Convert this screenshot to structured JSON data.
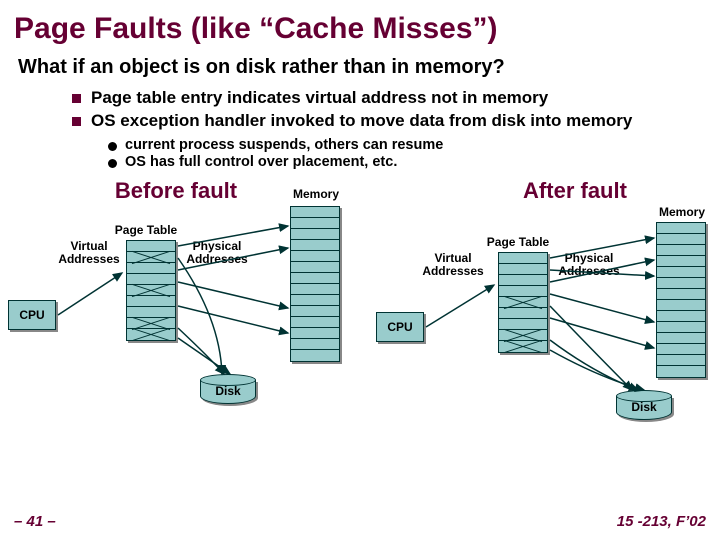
{
  "title": "Page Faults (like “Cache Misses”)",
  "subtitle": "What if an object is on disk rather than in memory?",
  "bullets": [
    "Page table entry indicates virtual address not in memory",
    "OS exception handler invoked to move data from disk into memory"
  ],
  "sub_bullets": [
    "current process suspends, others can resume",
    "OS has full control over placement, etc."
  ],
  "diagrams": {
    "before": {
      "title": "Before fault",
      "labels": {
        "memory": "Memory",
        "page_table": "Page Table",
        "virtual": "Virtual\nAddresses",
        "physical": "Physical\nAddresses",
        "cpu": "CPU",
        "disk": "Disk"
      }
    },
    "after": {
      "title": "After fault",
      "labels": {
        "memory": "Memory",
        "page_table": "Page Table",
        "virtual": "Virtual\nAddresses",
        "physical": "Physical\nAddresses",
        "cpu": "CPU",
        "disk": "Disk"
      }
    }
  },
  "footer": {
    "left": "– 41 –",
    "right": "15 -213, F’02"
  },
  "colors": {
    "accent": "#660033",
    "box_fill": "#99cccc",
    "box_border": "#003333"
  }
}
